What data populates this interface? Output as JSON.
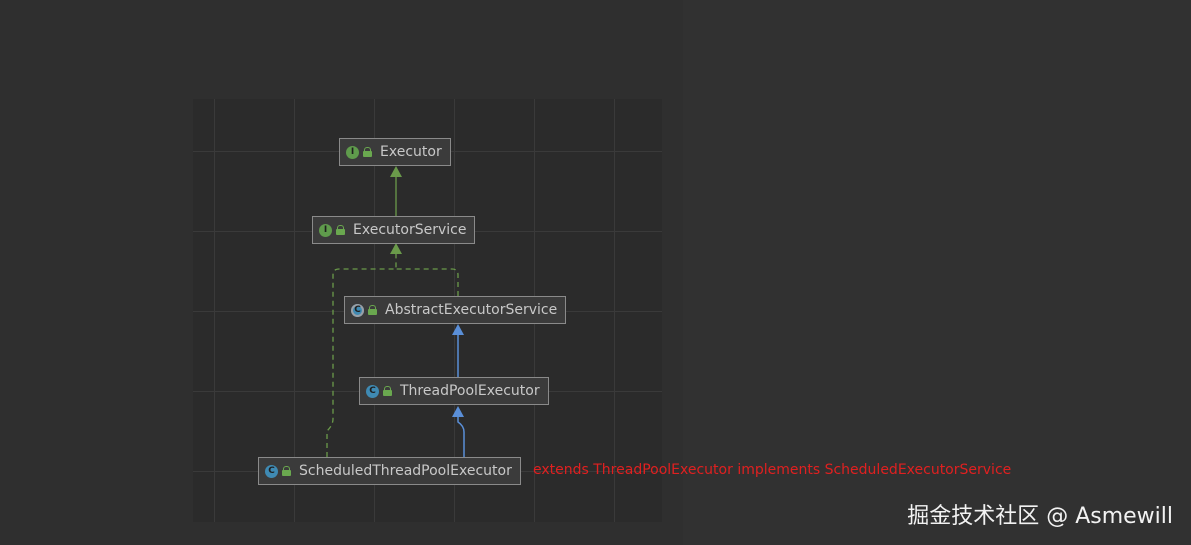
{
  "diagram": {
    "nodes": [
      {
        "id": "executor",
        "label": "Executor",
        "kind": "interface",
        "badge": "I"
      },
      {
        "id": "executor_service",
        "label": "ExecutorService",
        "kind": "interface",
        "badge": "I"
      },
      {
        "id": "abstract_executor_service",
        "label": "AbstractExecutorService",
        "kind": "abstract-class",
        "badge": "C"
      },
      {
        "id": "thread_pool_executor",
        "label": "ThreadPoolExecutor",
        "kind": "class",
        "badge": "C"
      },
      {
        "id": "scheduled_thread_pool_executor",
        "label": "ScheduledThreadPoolExecutor",
        "kind": "class",
        "badge": "C"
      }
    ],
    "edges": [
      {
        "from": "executor_service",
        "to": "executor",
        "type": "extends-interface",
        "color": "#6a9a4a"
      },
      {
        "from": "abstract_executor_service",
        "to": "executor_service",
        "type": "implements",
        "color": "#6a9a4a"
      },
      {
        "from": "scheduled_thread_pool_executor",
        "to": "executor_service",
        "type": "implements",
        "color": "#6a9a4a"
      },
      {
        "from": "thread_pool_executor",
        "to": "abstract_executor_service",
        "type": "extends",
        "color": "#5a8fd8"
      },
      {
        "from": "scheduled_thread_pool_executor",
        "to": "thread_pool_executor",
        "type": "extends",
        "color": "#5a8fd8"
      }
    ],
    "annotation": "extends ThreadPoolExecutor implements ScheduledExecutorService",
    "annotation_color": "#e02020"
  },
  "watermark": "掘金技术社区 @ Asmewill",
  "colors": {
    "interface_badge": "#5f9b4c",
    "class_badge": "#3f8ab3",
    "node_border": "#8a8a8a",
    "canvas_bg": "#2b2b2b"
  }
}
